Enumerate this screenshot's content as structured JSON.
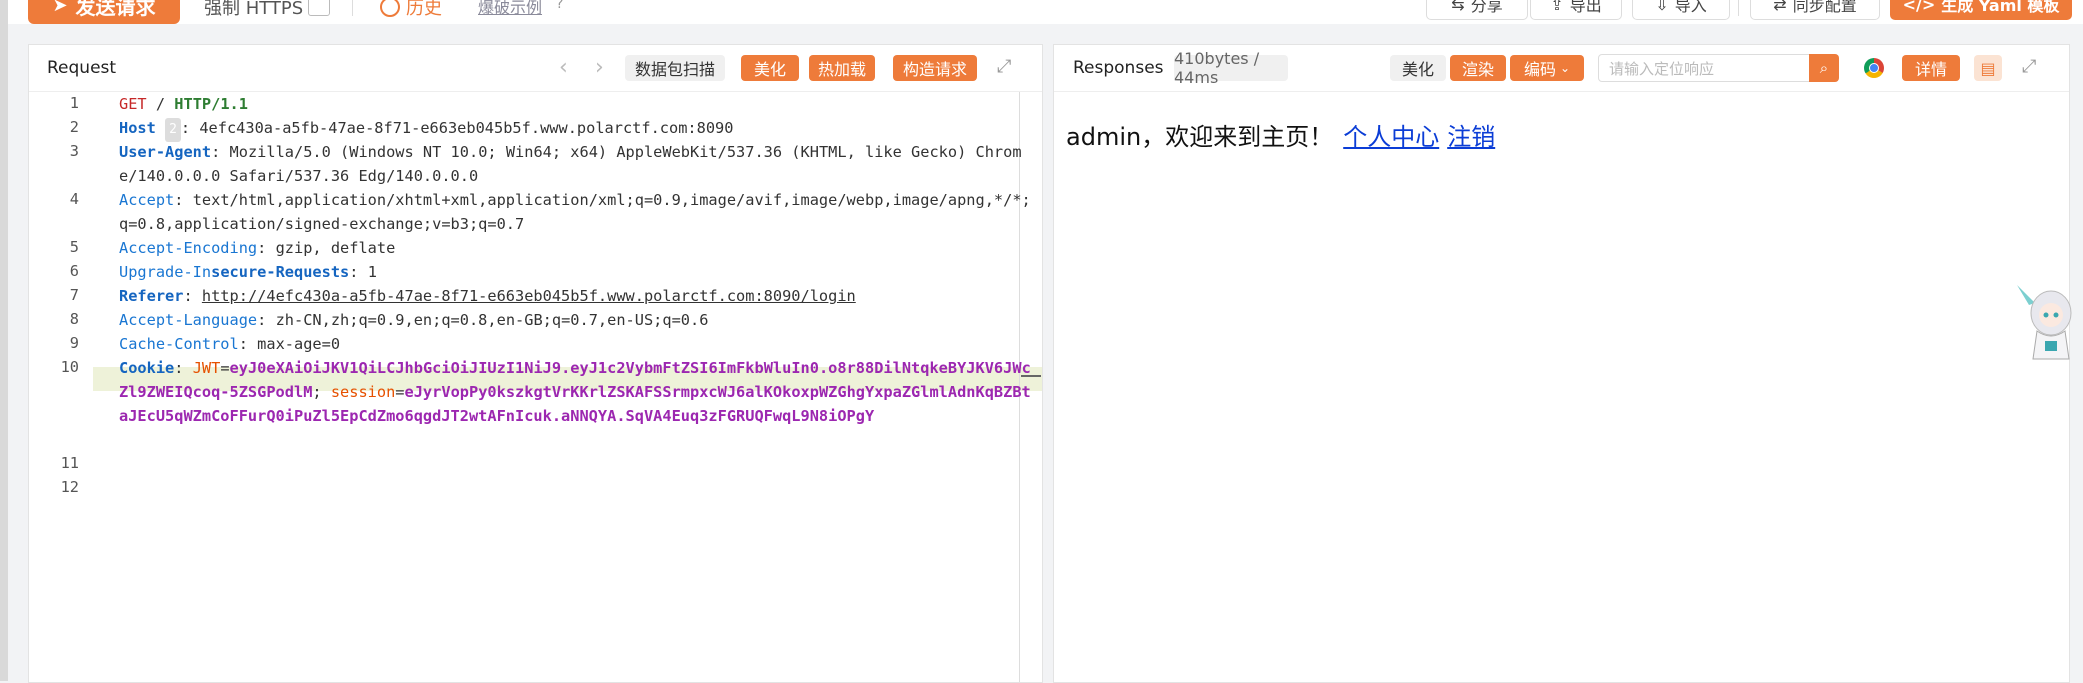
{
  "toolbar": {
    "send_label": "发送请求",
    "https_label": "强制 HTTPS",
    "history_label": "历史",
    "example_label": "爆破示例",
    "share_label": "分享",
    "export_label": "导出",
    "import_label": "导入",
    "sync_label": "同步配置",
    "yaml_label": "生成 Yaml 模板"
  },
  "request": {
    "title": "Request",
    "scan_label": "数据包扫描",
    "beautify_label": "美化",
    "hotload_label": "热加载",
    "build_label": "构造请求",
    "line_numbers": [
      "1",
      "2",
      "3",
      "4",
      "5",
      "6",
      "7",
      "8",
      "9",
      "10",
      "11",
      "12"
    ],
    "method": "GET",
    "path": "/",
    "version": "HTTP/1.1",
    "host_key": "Host",
    "host_badge": "2",
    "host_val": "4efc430a-a5fb-47ae-8f71-e663eb045b5f.www.polarctf.com:8090",
    "ua_key": "User-Agent",
    "ua_val": "Mozilla/5.0 (Windows NT 10.0; Win64; x64) AppleWebKit/537.36 (KHTML, like Gecko) Chrome/140.0.0.0 Safari/537.36 Edg/140.0.0.0",
    "accept_key": "Accept",
    "accept_val": "text/html,application/xhtml+xml,application/xml;q=0.9,image/avif,image/webp,image/apng,*/*;q=0.8,application/signed-exchange;v=b3;q=0.7",
    "ae_key": "Accept-Encoding",
    "ae_val": "gzip, deflate",
    "uir_key_a": "Upgrade-In",
    "uir_key_b": "secure-Requests",
    "uir_val": "1",
    "referer_key": "Referer",
    "referer_val": "http://4efc430a-a5fb-47ae-8f71-e663eb045b5f.www.polarctf.com:8090/login",
    "al_key": "Accept-Language",
    "al_val": "zh-CN,zh;q=0.9,en;q=0.8,en-GB;q=0.7,en-US;q=0.6",
    "cc_key": "Cache-Control",
    "cc_val": "max-age=0",
    "cookie_key": "Cookie",
    "jwt_name": "JWT",
    "jwt_val": "eyJ0eXAiOiJKV1QiLCJhbGciOiJIUzI1NiJ9.eyJ1c2VybmFtZSI6ImFkbWluIn0.o8r88DilNtqkeBYJKV6JWcZl9ZWEIQcoq-5ZSGPodlM",
    "session_name": "session",
    "session_val": "eJyrVopPy0kszkgtVrKKrlZSKAFSSrmpxcWJ6alKOkoxpWZGhgYxpaZGlmlAdnKqBZBtaJEcU5qWZmCoFFurQ0iPuZl5EpCdZmo6qgdJT2wtAFnIcuk.aNNQYA.SqVA4Euq3zFGRUQFwqL9N8iOPgY"
  },
  "response": {
    "title": "Responses",
    "meta": "410bytes / 44ms",
    "beautify_label": "美化",
    "render_label": "渲染",
    "encode_label": "编码",
    "search_placeholder": "请输入定位响应",
    "detail_label": "详情",
    "body_text": "admin，欢迎来到主页！",
    "link_profile": "个人中心",
    "link_logout": "注销"
  },
  "colors": {
    "accent": "#ee7b3a",
    "link": "#0b3dd6"
  }
}
